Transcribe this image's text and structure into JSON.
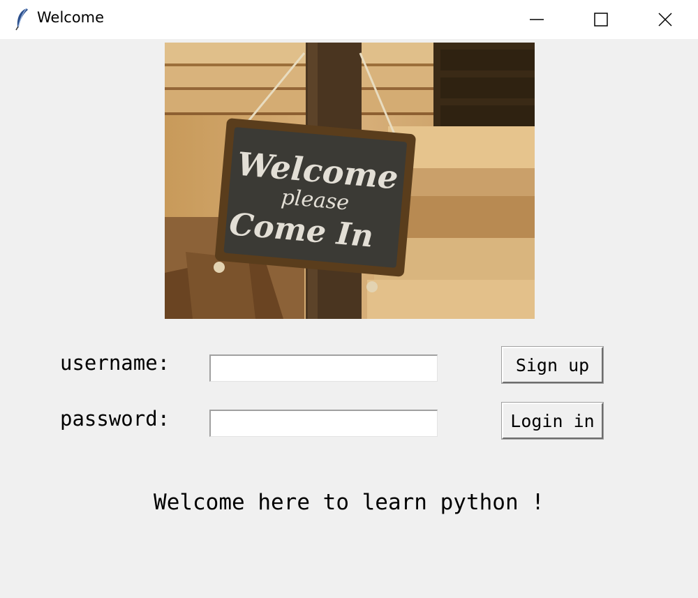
{
  "window": {
    "title": "Welcome",
    "controls": {
      "minimize": "minimize-icon",
      "maximize": "maximize-icon",
      "close": "close-icon"
    }
  },
  "image": {
    "sign_text": [
      "Welcome",
      "please",
      "Come In"
    ]
  },
  "form": {
    "username_label": "username:",
    "password_label": "password:",
    "username_value": "",
    "password_value": ""
  },
  "buttons": {
    "signup_label": "Sign up",
    "login_label": "Login in"
  },
  "message": "Welcome here to learn python !"
}
